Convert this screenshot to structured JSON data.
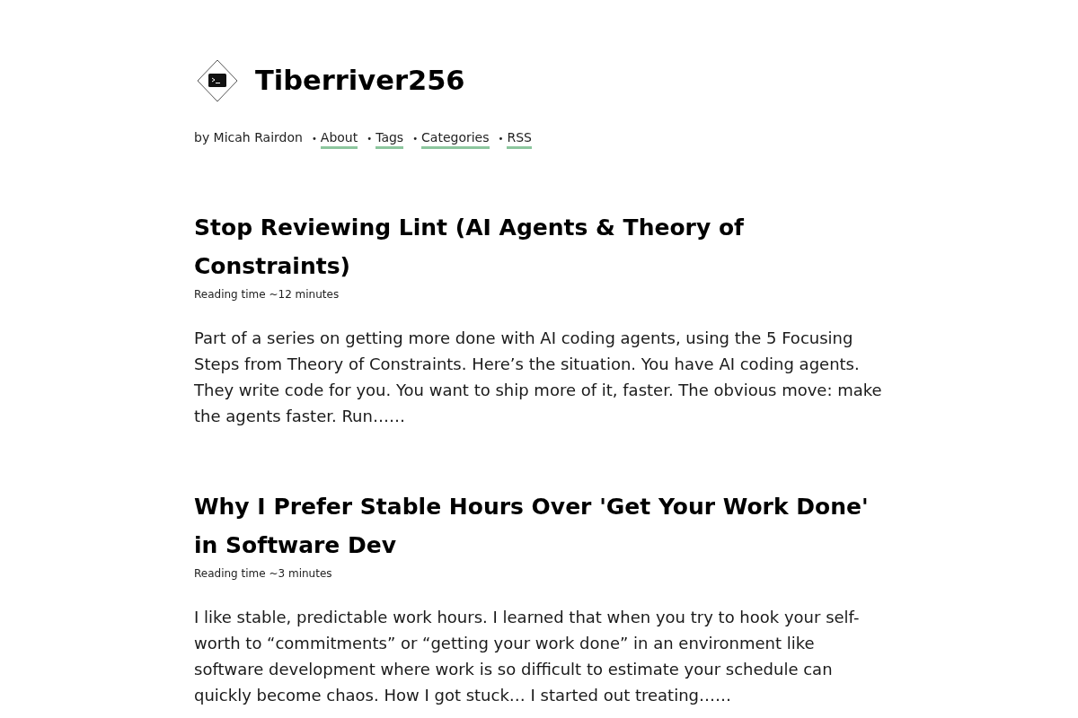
{
  "site": {
    "title": "Tiberriver256"
  },
  "byline": {
    "author": "by Micah Rairdon",
    "links": [
      {
        "bullet": "•",
        "label": "About"
      },
      {
        "bullet": "•",
        "label": "Tags"
      },
      {
        "bullet": "•",
        "label": "Categories"
      },
      {
        "bullet": "•",
        "label": "RSS"
      }
    ]
  },
  "posts": [
    {
      "title": "Stop Reviewing Lint (AI Agents & Theory of Constraints)",
      "reading_time": "Reading time ~12 minutes",
      "excerpt": "Part of a series on getting more done with AI coding agents, using the 5 Focusing Steps from Theory of Constraints. Here’s the situation. You have AI coding agents. They write code for you. You want to ship more of it, faster. The obvious move: make the agents faster. Run……"
    },
    {
      "title": "Why I Prefer Stable Hours Over 'Get Your Work Done' in Software Dev",
      "reading_time": "Reading time ~3 minutes",
      "excerpt": "I like stable, predictable work hours. I learned that when you try to hook your self-worth to “commitments” or “getting your work done” in an environment like software development where work is so difficult to estimate your schedule can quickly become chaos. How I got stuck… I started out treating……"
    }
  ]
}
